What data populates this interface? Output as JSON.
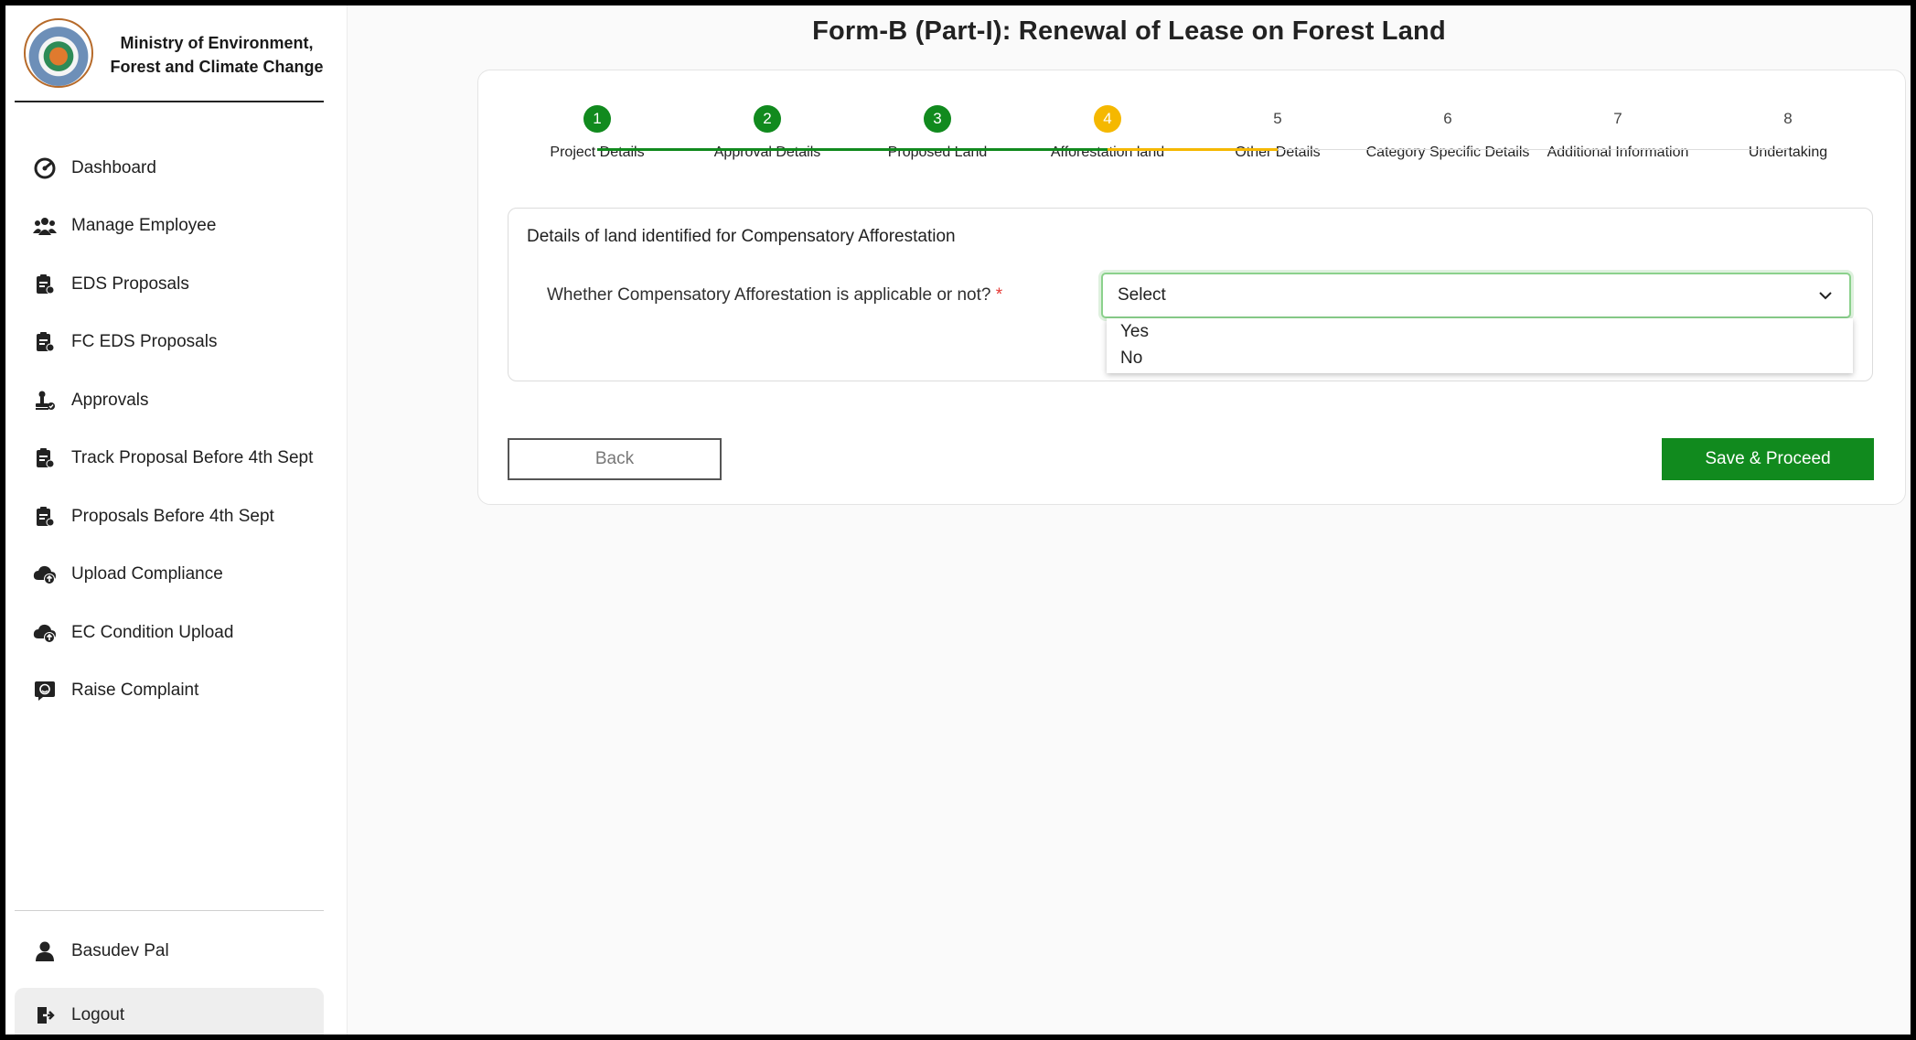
{
  "brand": {
    "line1": "Ministry of Environment,",
    "line2": "Forest and Climate Change"
  },
  "sidebar": {
    "items": [
      {
        "label": "Dashboard",
        "icon": "dashboard-icon"
      },
      {
        "label": "Manage Employee",
        "icon": "users-icon"
      },
      {
        "label": "EDS Proposals",
        "icon": "document-icon"
      },
      {
        "label": "FC EDS Proposals",
        "icon": "document-icon"
      },
      {
        "label": "Approvals",
        "icon": "stamp-icon"
      },
      {
        "label": "Track Proposal Before 4th Sept",
        "icon": "document-icon"
      },
      {
        "label": "Proposals Before 4th Sept",
        "icon": "document-icon"
      },
      {
        "label": "Upload Compliance",
        "icon": "cloud-upload-icon"
      },
      {
        "label": "EC Condition Upload",
        "icon": "cloud-upload-icon"
      },
      {
        "label": "Raise Complaint",
        "icon": "complaint-icon"
      }
    ],
    "user": "Basudev Pal",
    "logout": "Logout"
  },
  "page": {
    "title": "Form-B (Part-I): Renewal of Lease on Forest Land"
  },
  "stepper": {
    "steps": [
      {
        "num": "1",
        "label": "Project Details",
        "state": "done"
      },
      {
        "num": "2",
        "label": "Approval Details",
        "state": "done"
      },
      {
        "num": "3",
        "label": "Proposed Land",
        "state": "done"
      },
      {
        "num": "4",
        "label": "Afforestation land",
        "state": "active"
      },
      {
        "num": "5",
        "label": "Other Details",
        "state": "todo"
      },
      {
        "num": "6",
        "label": "Category Specific Details",
        "state": "todo"
      },
      {
        "num": "7",
        "label": "Additional Information",
        "state": "todo"
      },
      {
        "num": "8",
        "label": "Undertaking",
        "state": "todo"
      }
    ],
    "colors": {
      "done": "#118a1e",
      "active": "#f5b800"
    }
  },
  "section": {
    "title": "Details of land identified for Compensatory Afforestation",
    "question": "Whether Compensatory Afforestation is applicable or not?",
    "required_mark": "*",
    "select": {
      "value": "Select",
      "options": [
        "Yes",
        "No"
      ]
    }
  },
  "actions": {
    "back": "Back",
    "save": "Save & Proceed"
  }
}
